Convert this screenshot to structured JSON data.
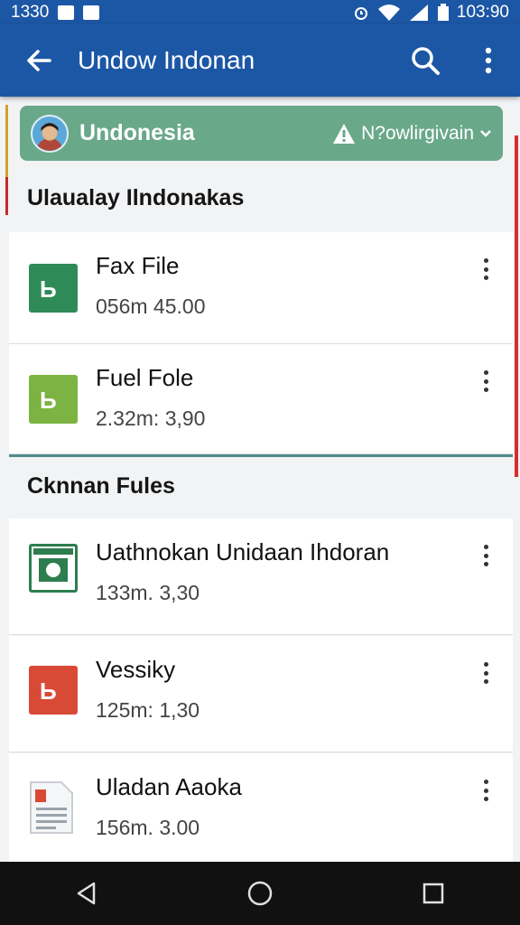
{
  "status_bar": {
    "time_left": "1330",
    "time_right": "103:90"
  },
  "app_bar": {
    "title": "Undow Indonan"
  },
  "region": {
    "name": "Undonesia",
    "selector": "N?owlirgivain"
  },
  "sections": [
    {
      "title": "Ulaualay Ilndonakas",
      "items": [
        {
          "name": "Fax File",
          "meta": "056m 45.00",
          "icon": "file-green-icon",
          "icon_color": "#2e8b57"
        },
        {
          "name": "Fuel Fole",
          "meta": "2.32m: 3,90",
          "icon": "file-lime-icon",
          "icon_color": "#7cb342"
        }
      ]
    },
    {
      "title": "Cknnan Fules",
      "items": [
        {
          "name": "Uathnokan Unidaan Ihdoran",
          "meta": "133m. 3,30",
          "icon": "sheet-green-icon",
          "icon_color": "#2e7d4f"
        },
        {
          "name": "Vessiky",
          "meta": "125m: 1,30",
          "icon": "file-red-icon",
          "icon_color": "#d84a36"
        },
        {
          "name": "Uladan Aaoka",
          "meta": "156m. 3.00",
          "icon": "document-icon",
          "icon_color": "#e8ecef"
        }
      ]
    }
  ],
  "colors": {
    "app_bar": "#1c57a5",
    "region_bar": "#6aa88a",
    "divider": "#4d8d8d"
  }
}
